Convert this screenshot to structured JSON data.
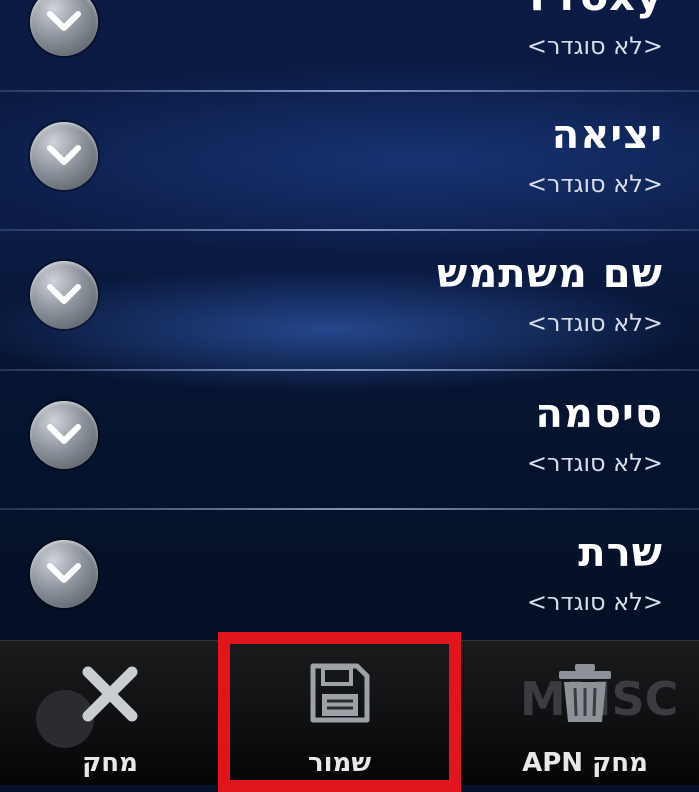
{
  "settings_list": {
    "items": [
      {
        "title": "Proxy",
        "summary": "<לא סוגדר>"
      },
      {
        "title": "יציאה",
        "summary": "<לא סוגדר>"
      },
      {
        "title": "שם משתמש",
        "summary": "<לא סוגדר>"
      },
      {
        "title": "סיסמה",
        "summary": "<לא סוגדר>"
      },
      {
        "title": "שרת",
        "summary": "<לא סוגדר>"
      }
    ]
  },
  "bottom_bar": {
    "delete_label": "מחק",
    "save_label": "שמור",
    "delete_apn_label": "מחק APN",
    "faint_text": "MMSC"
  },
  "colors": {
    "highlight": "#e1151c",
    "title_text": "#ffffff",
    "summary_text": "#d8dde8"
  },
  "icons": {
    "chevron": "chevron-down-icon",
    "delete": "close-icon",
    "save": "floppy-disk-icon",
    "delete_apn": "trash-icon"
  }
}
